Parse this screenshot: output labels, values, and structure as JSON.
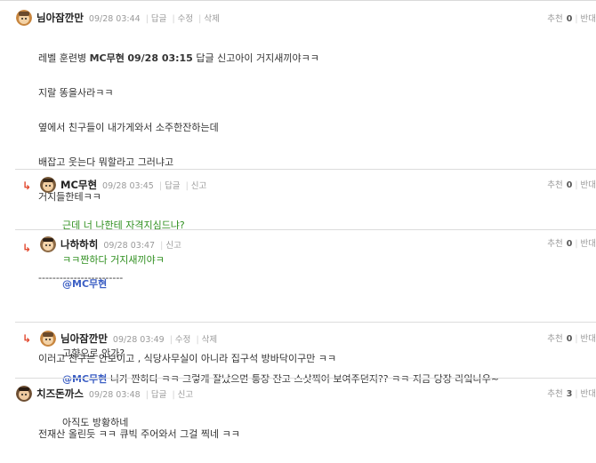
{
  "labels": {
    "recommend": "추천",
    "against": "반대",
    "reply": "답글",
    "edit": "수정",
    "delete": "삭제",
    "report": "신고",
    "reply_arrow": "↳"
  },
  "comments": [
    {
      "nick": "님아잠깐만",
      "time": "09/28 03:44",
      "recommend": "0",
      "lines": [
        {
          "pre": "레벨 훈련병 ",
          "bold": "MC무현",
          "mid": " ",
          "bold2": "09/28 03:15",
          "post": " 답글 신고아이 거지새끼야ㅋㅋ"
        },
        {
          "text": "지랄 똥을사라ㅋㅋ"
        },
        {
          "text": "옆에서 친구들이 내가게와서 소주한잔하는데"
        },
        {
          "text": "배잡고 웃는다 뭐할라고 그러냐고"
        },
        {
          "text": "거지들한테ㅋㅋ"
        },
        {
          "text": "------------------------"
        },
        {
          "text": "이러고 친구는 안보이고 , 식당사무실이 아니라 집구석 방바닥이구만 ㅋㅋ"
        }
      ]
    },
    {
      "nick": "MC무현",
      "time": "09/28 03:45",
      "recommend": "0",
      "lines": [
        {
          "text": "근데 너 나한테 자격지심드냐?"
        },
        {
          "text": "ㅋㅋ짠하다 거지새끼야ㅋ"
        }
      ]
    },
    {
      "nick": "나하하히",
      "time": "09/28 03:47",
      "recommend": "0",
      "lines": [
        {
          "mention": "@MC무현"
        },
        {
          "text": "고향으로 안가?"
        },
        {
          "text": "아직도 방황하네"
        }
      ]
    },
    {
      "nick": "님아잠깐만",
      "time": "09/28 03:49",
      "recommend": "0",
      "lines": [
        {
          "mention": "@MC무현",
          "post": " 니가 짠하다 ㅋㅋ 그렇게 잘났으면 통장 잔고 스샷찍어 보여주던지?? ㅋㅋ 지금 당장 라잌나우~"
        }
      ]
    },
    {
      "nick": "치즈돈까스",
      "time": "09/28 03:48",
      "recommend": "3",
      "lines": [
        {
          "text": "전재산 올린듯 ㅋㅋ 큐빅 주어와서 그걸 찍네 ㅋㅋ"
        }
      ]
    }
  ]
}
